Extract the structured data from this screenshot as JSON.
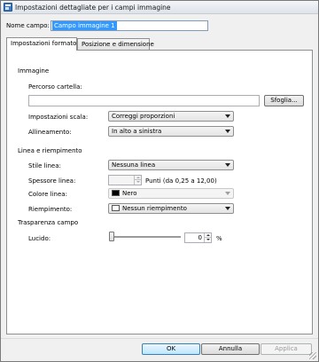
{
  "window": {
    "title": "Impostazioni dettagliate per i campi immagine"
  },
  "field_name": {
    "label": "Nome campo:",
    "value": "Campo immagine 1"
  },
  "tabs": [
    {
      "label": "Impostazioni formato",
      "active": true
    },
    {
      "label": "Posizione e dimensione",
      "active": false
    }
  ],
  "image_section": {
    "title": "Immagine",
    "folder_path_label": "Percorso cartella:",
    "folder_path_value": "",
    "browse_label": "Sfoglia...",
    "scale_label": "Impostazioni scala:",
    "scale_value": "Correggi proporzioni",
    "align_label": "Allineamento:",
    "align_value": "In alto a sinistra"
  },
  "line_section": {
    "title": "Linea e riempimento",
    "style_label": "Stile linea:",
    "style_value": "Nessuna linea",
    "thickness_label": "Spessore linea:",
    "thickness_value": "",
    "thickness_hint": "Punti (da 0,25 a 12,00)",
    "color_label": "Colore linea:",
    "color_value": "Nero",
    "color_swatch": "#000000",
    "fill_label": "Riempimento:",
    "fill_value": "Nessun riempimento",
    "fill_swatch": "#ffffff"
  },
  "transparency_section": {
    "title": "Trasparenza campo",
    "opacity_label": "Lucido:",
    "opacity_value": "0",
    "opacity_unit": "%",
    "opacity_level": 0
  },
  "footer": {
    "ok": "OK",
    "cancel": "Annulla",
    "apply": "Applica"
  }
}
